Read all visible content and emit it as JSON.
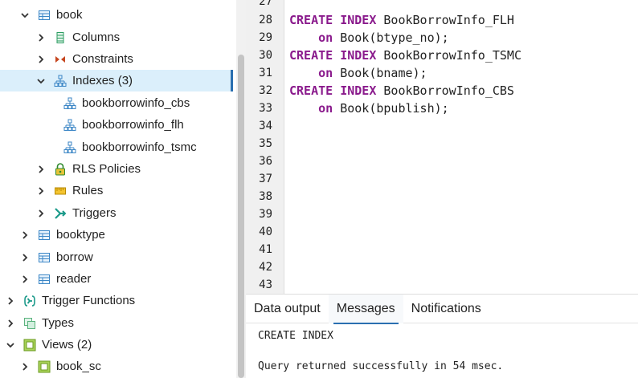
{
  "tree": {
    "items": [
      {
        "label": "book",
        "icon": "table-icon"
      },
      {
        "label": "Columns",
        "icon": "columns-icon"
      },
      {
        "label": "Constraints",
        "icon": "constraints-icon"
      },
      {
        "label": "Indexes (3)",
        "icon": "index-icon"
      },
      {
        "label": "bookborrowinfo_cbs",
        "icon": "index-icon"
      },
      {
        "label": "bookborrowinfo_flh",
        "icon": "index-icon"
      },
      {
        "label": "bookborrowinfo_tsmc",
        "icon": "index-icon"
      },
      {
        "label": "RLS Policies",
        "icon": "lock-icon"
      },
      {
        "label": "Rules",
        "icon": "rules-icon"
      },
      {
        "label": "Triggers",
        "icon": "trigger-icon"
      },
      {
        "label": "booktype",
        "icon": "table-icon"
      },
      {
        "label": "borrow",
        "icon": "table-icon"
      },
      {
        "label": "reader",
        "icon": "table-icon"
      },
      {
        "label": "Trigger Functions",
        "icon": "trigger-function-icon"
      },
      {
        "label": "Types",
        "icon": "types-icon"
      },
      {
        "label": "Views (2)",
        "icon": "views-icon"
      },
      {
        "label": "book_sc",
        "icon": "view-icon"
      }
    ]
  },
  "editor": {
    "line_numbers": [
      "27",
      "28",
      "29",
      "30",
      "31",
      "32",
      "33",
      "34",
      "35",
      "36",
      "37",
      "38",
      "39",
      "40",
      "41",
      "42",
      "43"
    ],
    "lines": [
      {
        "kw1": "",
        "kw2": "",
        "rest": ""
      },
      {
        "kw1": "CREATE",
        "kw2": "INDEX",
        "rest": " BookBorrowInfo_FLH"
      },
      {
        "kw1": "    on",
        "kw2": "",
        "rest": " Book(btype_no);"
      },
      {
        "kw1": "CREATE",
        "kw2": "INDEX",
        "rest": " BookBorrowInfo_TSMC"
      },
      {
        "kw1": "    on",
        "kw2": "",
        "rest": " Book(bname);"
      },
      {
        "kw1": "CREATE",
        "kw2": "INDEX",
        "rest": " BookBorrowInfo_CBS"
      },
      {
        "kw1": "    on",
        "kw2": "",
        "rest": " Book(bpublish);"
      }
    ]
  },
  "bottom": {
    "tabs": [
      "Data output",
      "Messages",
      "Notifications"
    ],
    "active_tab": "Messages",
    "messages": [
      "CREATE INDEX",
      "Query returned successfully in 54 msec."
    ]
  },
  "colors": {
    "keyword": "#8a1a8c",
    "selection": "#dbeffb",
    "accent": "#2a6fb0"
  }
}
